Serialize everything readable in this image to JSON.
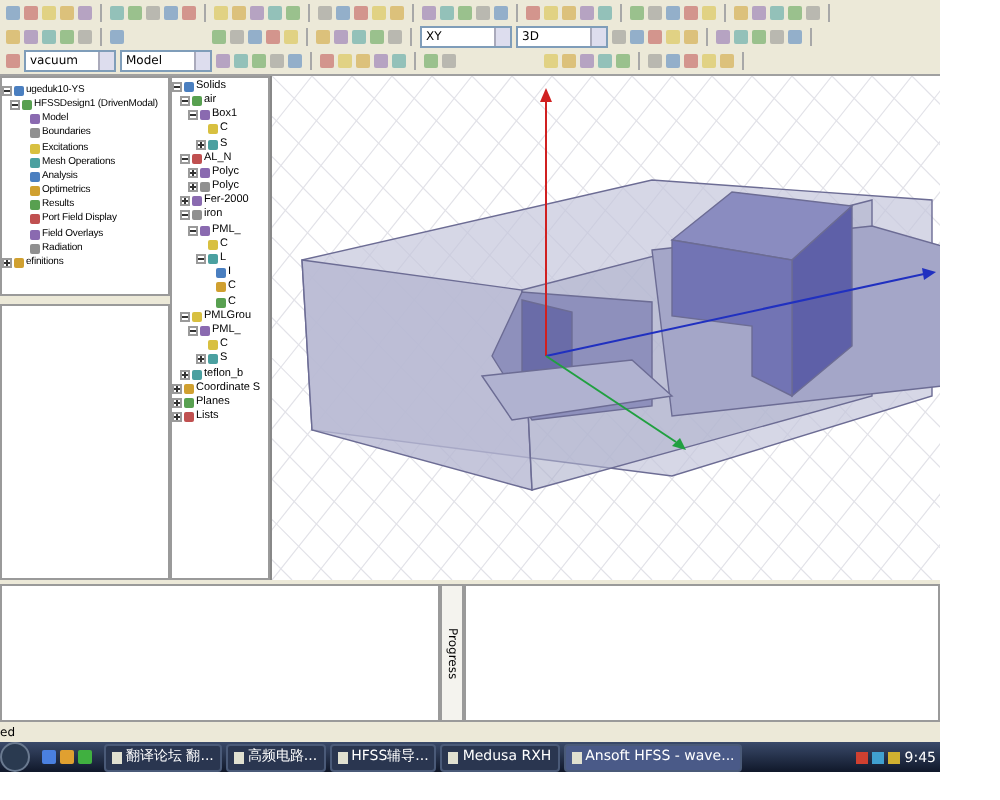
{
  "toolbars": {
    "material_select": "vacuum",
    "context_select": "Model",
    "plane_select": "XY",
    "view_select": "3D"
  },
  "project_tree": [
    {
      "label": "ugeduk10-YS",
      "expanded": true,
      "children": [
        {
          "label": "HFSSDesign1 (DrivenModal)",
          "expanded": true,
          "children": [
            {
              "label": "Model"
            },
            {
              "label": "Boundaries"
            },
            {
              "label": "Excitations"
            },
            {
              "label": "Mesh Operations"
            },
            {
              "label": "Analysis"
            },
            {
              "label": "Optimetrics"
            },
            {
              "label": "Results"
            },
            {
              "label": "Port Field Display"
            },
            {
              "label": "Field Overlays"
            },
            {
              "label": "Radiation"
            }
          ]
        }
      ]
    },
    {
      "label": "efinitions",
      "expanded": false
    }
  ],
  "model_tree": [
    {
      "label": "Solids",
      "expanded": true,
      "children": [
        {
          "label": "air",
          "expanded": true,
          "children": [
            {
              "label": "Box1",
              "expanded": true,
              "children": [
                {
                  "label": "C"
                },
                {
                  "label": "S",
                  "expanded": false
                }
              ]
            }
          ]
        },
        {
          "label": "AL_N",
          "expanded": true,
          "children": [
            {
              "label": "Polyc",
              "expanded": false
            },
            {
              "label": "Polyc",
              "expanded": false
            }
          ]
        },
        {
          "label": "Fer-2000",
          "expanded": false
        },
        {
          "label": "iron",
          "expanded": true,
          "children": [
            {
              "label": "PML_",
              "expanded": true,
              "children": [
                {
                  "label": "C"
                },
                {
                  "label": "L",
                  "expanded": true,
                  "children": [
                    {
                      "label": "I"
                    },
                    {
                      "label": "C"
                    },
                    {
                      "label": "C"
                    }
                  ]
                }
              ]
            }
          ]
        },
        {
          "label": "PMLGrou",
          "expanded": true,
          "children": [
            {
              "label": "PML_",
              "expanded": true,
              "children": [
                {
                  "label": "C"
                },
                {
                  "label": "S",
                  "expanded": false
                }
              ]
            }
          ]
        },
        {
          "label": "teflon_b",
          "expanded": false
        }
      ]
    },
    {
      "label": "Coordinate S",
      "expanded": false
    },
    {
      "label": "Planes",
      "expanded": false
    },
    {
      "label": "Lists",
      "expanded": false
    }
  ],
  "progress_tab": "Progress",
  "status_bar": "ed",
  "taskbar": {
    "tasks": [
      {
        "label": "翻译论坛 翻...",
        "selected": false
      },
      {
        "label": "高频电路...",
        "selected": false
      },
      {
        "label": "HFSS辅导...",
        "selected": false
      },
      {
        "label": "Medusa RXH",
        "selected": false
      },
      {
        "label": "Ansoft HFSS - wave...",
        "selected": true
      }
    ],
    "clock": "9:45"
  }
}
